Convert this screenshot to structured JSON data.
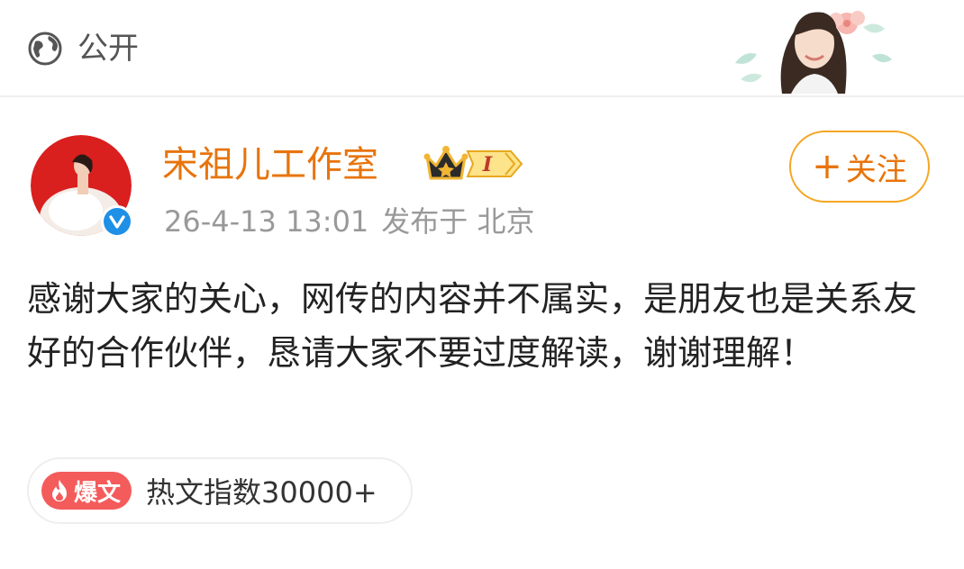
{
  "visibility": {
    "label": "公开",
    "icon": "globe-icon"
  },
  "author": {
    "name": "宋祖儿工作室",
    "verified_icon": "verified-v-icon",
    "crown_icon": "crown-icon",
    "level_badge": "I"
  },
  "post_meta": {
    "datetime": "26-4-13 13:01",
    "published_at": "发布于 北京"
  },
  "follow_button": {
    "label": "关注",
    "icon": "plus-icon"
  },
  "post": {
    "text": "感谢大家的关心，网传的内容并不属实，是朋友也是关系友好的合作伙伴，恳请大家不要过度解读，谢谢理解！"
  },
  "hot": {
    "tag": "爆文",
    "index_text": "热文指数30000+"
  },
  "colors": {
    "accent": "#e8740c",
    "follow_border": "#f5a623",
    "verified": "#1e90e6",
    "hot_tag": "#f45b5b"
  }
}
